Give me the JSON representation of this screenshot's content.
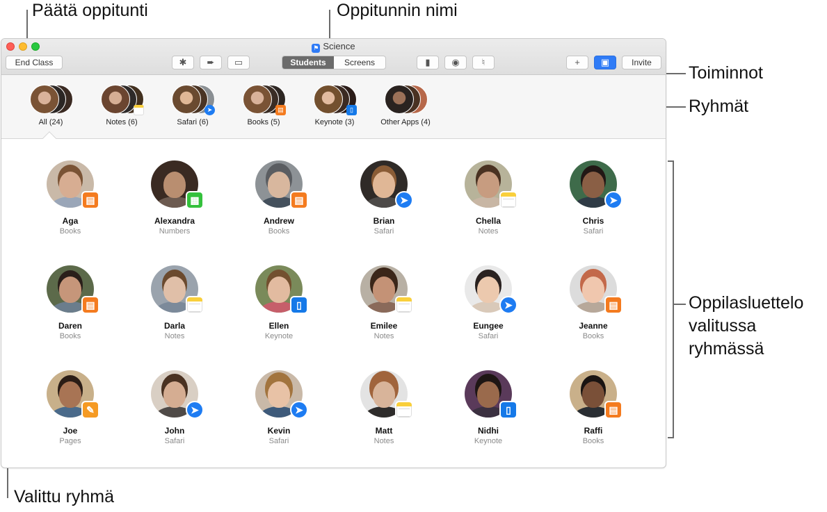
{
  "callouts": {
    "end_class": "Päätä oppitunti",
    "class_name": "Oppitunnin nimi",
    "actions": "Toiminnot",
    "groups": "Ryhmät",
    "student_list": "Oppilasluettelo valitussa ryhmässä",
    "selected_group": "Valittu ryhmä"
  },
  "window": {
    "title": "Science",
    "toolbar": {
      "end_class_label": "End Class",
      "tabs": [
        "Students",
        "Screens"
      ],
      "active_tab": "Students",
      "invite_label": "Invite",
      "add_label": "+"
    }
  },
  "groups": [
    {
      "label": "All (24)",
      "app": "",
      "selected": true
    },
    {
      "label": "Notes (6)",
      "app": "notes"
    },
    {
      "label": "Safari (6)",
      "app": "safari"
    },
    {
      "label": "Books (5)",
      "app": "books"
    },
    {
      "label": "Keynote (3)",
      "app": "keynote"
    },
    {
      "label": "Other Apps (4)",
      "app": ""
    }
  ],
  "students": [
    {
      "name": "Aga",
      "app": "Books"
    },
    {
      "name": "Alexandra",
      "app": "Numbers"
    },
    {
      "name": "Andrew",
      "app": "Books"
    },
    {
      "name": "Brian",
      "app": "Safari"
    },
    {
      "name": "Chella",
      "app": "Notes"
    },
    {
      "name": "Chris",
      "app": "Safari"
    },
    {
      "name": "Daren",
      "app": "Books"
    },
    {
      "name": "Darla",
      "app": "Notes"
    },
    {
      "name": "Ellen",
      "app": "Keynote"
    },
    {
      "name": "Emilee",
      "app": "Notes"
    },
    {
      "name": "Eungee",
      "app": "Safari"
    },
    {
      "name": "Jeanne",
      "app": "Books"
    },
    {
      "name": "Joe",
      "app": "Pages"
    },
    {
      "name": "John",
      "app": "Safari"
    },
    {
      "name": "Kevin",
      "app": "Safari"
    },
    {
      "name": "Matt",
      "app": "Notes"
    },
    {
      "name": "Nidhi",
      "app": "Keynote"
    },
    {
      "name": "Raffi",
      "app": "Books"
    }
  ],
  "colors": {
    "books": "#f47b1f",
    "numbers": "#34c13c",
    "safari": "#1e7cf2",
    "keynote": "#1579e8",
    "pages": "#f59a23",
    "accent": "#2f7bf6"
  }
}
